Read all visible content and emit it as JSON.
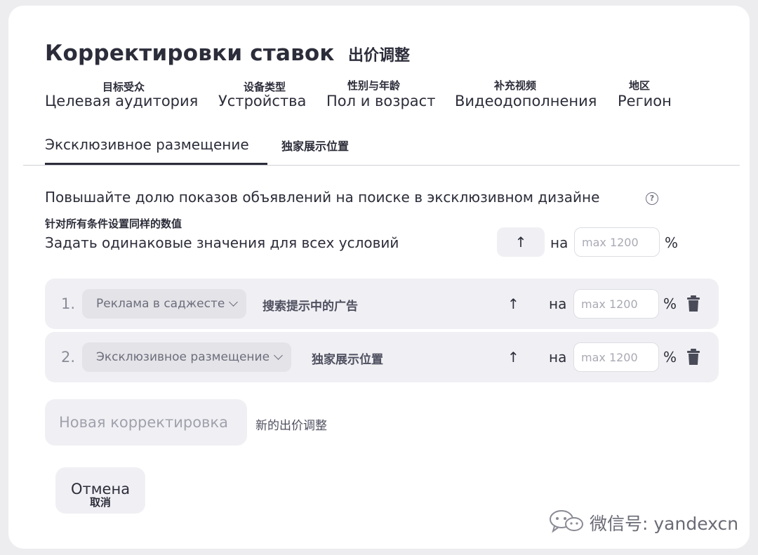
{
  "header": {
    "title": "Корректировки ставок",
    "title_cn": "出价调整"
  },
  "tabs": [
    {
      "cn": "目标受众",
      "label": "Целевая аудитория"
    },
    {
      "cn": "设备类型",
      "label": "Устройства"
    },
    {
      "cn": "性别与年龄",
      "label": "Пол и возраст"
    },
    {
      "cn": "补充视频",
      "label": "Видеодополнения"
    },
    {
      "cn": "地区",
      "label": "Регион"
    }
  ],
  "subtab": {
    "label": "Эксклюзивное размещение",
    "cn": "独家展示位置"
  },
  "description": {
    "text": "Повышайте долю показов объявлений на поиске в эксклюзивном дизайне",
    "help_icon": "?"
  },
  "same_values": {
    "cn": "针对所有条件设置同样的数值",
    "label": "Задать одинаковые значения для всех условий",
    "arrow": "↑",
    "na": "на",
    "placeholder": "max 1200",
    "unit": "%"
  },
  "rows": [
    {
      "num": "1.",
      "select": "Реклама в саджесте",
      "cn": "搜索提示中的广告",
      "arrow": "↑",
      "na": "на",
      "placeholder": "max 1200",
      "unit": "%"
    },
    {
      "num": "2.",
      "select": "Эксклюзивное размещение",
      "cn": "独家展示位置",
      "arrow": "↑",
      "na": "на",
      "placeholder": "max 1200",
      "unit": "%"
    }
  ],
  "new_adjustment": {
    "label": "Новая корректировка",
    "cn": "新的出价调整"
  },
  "cancel": {
    "label": "Отмена",
    "cn": "取消"
  },
  "watermark": {
    "text": "微信号: yandexcn",
    "icon": "wechat-icon"
  }
}
